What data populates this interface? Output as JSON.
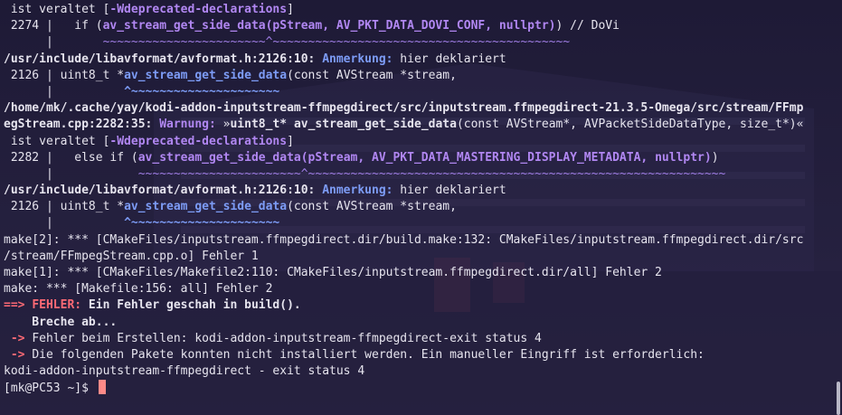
{
  "terminal": {
    "lines": [
      [
        {
          "t": " ist veraltet ["
        },
        {
          "t": "-Wdeprecated-declarations",
          "c": "pu"
        },
        {
          "t": "]"
        }
      ],
      [
        {
          "t": " 2274 |   if ("
        },
        {
          "t": "av_stream_get_side_data(pStream, AV_PKT_DATA_DOVI_CONF, nullptr)",
          "c": "pu"
        },
        {
          "t": ") // DoVi"
        }
      ],
      [
        {
          "t": "      |       "
        },
        {
          "t": "~~~~~~~~~~~~~~~~~~~~~~~^~~~~~~~~~~~~~~~~~~~~~~~~~~~~~~~~~~~~~~~~~~",
          "c": "pu-n"
        }
      ],
      [
        {
          "t": "/usr/include/libavformat/avformat.h:2126:10:",
          "c": "b"
        },
        {
          "t": " "
        },
        {
          "t": "Anmerkung:",
          "c": "bl"
        },
        {
          "t": " hier deklariert"
        }
      ],
      [
        {
          "t": " 2126 | uint8_t *"
        },
        {
          "t": "av_stream_get_side_data",
          "c": "bl"
        },
        {
          "t": "(const AVStream *stream,"
        }
      ],
      [
        {
          "t": "      |          "
        },
        {
          "t": "^~~~~~~~~~~~~~~~~~~~~~",
          "c": "bl"
        }
      ],
      [
        {
          "t": "/home/mk/.cache/yay/kodi-addon-inputstream-ffmpegdirect/src/inputstream.ffmpegdirect-21.3.5-Omega/src/stream/FFmp",
          "c": "b"
        }
      ],
      [
        {
          "t": "egStream.cpp:2282:35:",
          "c": "b"
        },
        {
          "t": " "
        },
        {
          "t": "Warnung:",
          "c": "pu"
        },
        {
          "t": " »"
        },
        {
          "t": "uint8_t* ",
          "c": "b"
        },
        {
          "t": "av_stream_get_side_data",
          "c": "b"
        },
        {
          "t": "(const AVStream*, AVPacketSideDataType, size_t*)«"
        }
      ],
      [
        {
          "t": " ist veraltet ["
        },
        {
          "t": "-Wdeprecated-declarations",
          "c": "pu"
        },
        {
          "t": "]"
        }
      ],
      [
        {
          "t": " 2282 |   else if ("
        },
        {
          "t": "av_stream_get_side_data(pStream, AV_PKT_DATA_MASTERING_DISPLAY_METADATA, nullptr)",
          "c": "pu"
        },
        {
          "t": ")"
        }
      ],
      [
        {
          "t": "      |            "
        },
        {
          "t": "~~~~~~~~~~~~~~~~~~~~~~~^~~~~~~~~~~~~~~~~~~~~~~~~~~~~~~~~~~~~~~~~~~~~~~~~~~~~~~~~~~~",
          "c": "pu-n"
        }
      ],
      [
        {
          "t": "/usr/include/libavformat/avformat.h:2126:10:",
          "c": "b"
        },
        {
          "t": " "
        },
        {
          "t": "Anmerkung:",
          "c": "bl"
        },
        {
          "t": " hier deklariert"
        }
      ],
      [
        {
          "t": " 2126 | uint8_t *"
        },
        {
          "t": "av_stream_get_side_data",
          "c": "bl"
        },
        {
          "t": "(const AVStream *stream,"
        }
      ],
      [
        {
          "t": "      |          "
        },
        {
          "t": "^~~~~~~~~~~~~~~~~~~~~~",
          "c": "bl"
        }
      ],
      [
        {
          "t": "make[2]: *** [CMakeFiles/inputstream.ffmpegdirect.dir/build.make:132: CMakeFiles/inputstream.ffmpegdirect.dir/src"
        }
      ],
      [
        {
          "t": "/stream/FFmpegStream.cpp.o] Fehler 1"
        }
      ],
      [
        {
          "t": "make[1]: *** [CMakeFiles/Makefile2:110: CMakeFiles/inputstream.ffmpegdirect.dir/all] Fehler 2"
        }
      ],
      [
        {
          "t": "make: *** [Makefile:156: all] Fehler 2"
        }
      ],
      [
        {
          "t": "==> ",
          "c": "rd"
        },
        {
          "t": "FEHLER:",
          "c": "rd"
        },
        {
          "t": " Ein Fehler geschah in build().",
          "c": "b"
        }
      ],
      [
        {
          "t": "    Breche ab...",
          "c": "b"
        }
      ],
      [
        {
          "t": " -> ",
          "c": "rd"
        },
        {
          "t": "Fehler beim Erstellen: kodi-addon-inputstream-ffmpegdirect-exit status 4"
        }
      ],
      [
        {
          "t": " -> ",
          "c": "rd"
        },
        {
          "t": "Die folgenden Pakete konnten nicht installiert werden. Ein manueller Eingriff ist erforderlich:"
        }
      ],
      [
        {
          "t": "kodi-addon-inputstream-ffmpegdirect - exit status 4"
        }
      ]
    ],
    "prompt": "[mk@PC53 ~]$ "
  },
  "colors": {
    "background": "#211d3b",
    "warning_purple": "#b187f2",
    "note_blue": "#7d9cf6",
    "error_red": "#ff6a75",
    "cursor": "#ff8a88"
  }
}
